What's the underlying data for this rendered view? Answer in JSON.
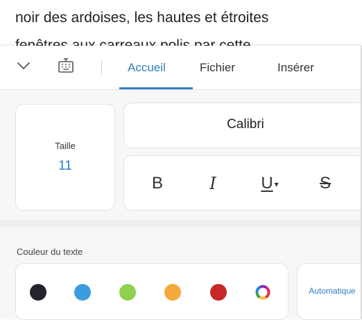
{
  "document": {
    "line1": "noir des ardoises, les hautes et étroites",
    "line2": "fenêtres aux carreaux polis par cette"
  },
  "toolbar": {
    "collapse_icon": "chevron-down-icon",
    "keyboard_icon": "keyboard-icon",
    "tabs": [
      {
        "label": "Accueil",
        "active": true
      },
      {
        "label": "Fichier",
        "active": false
      },
      {
        "label": "Insérer",
        "active": false
      }
    ]
  },
  "font": {
    "size_label": "Taille",
    "size_value": "11",
    "font_name": "Calibri",
    "format_buttons": {
      "bold": "B",
      "italic": "I",
      "underline": "U",
      "strikethrough": "S"
    }
  },
  "text_color": {
    "label": "Couleur du texte",
    "swatches": [
      {
        "name": "black",
        "color": "#23232b"
      },
      {
        "name": "blue",
        "color": "#3d9ce0"
      },
      {
        "name": "green",
        "color": "#8fd14f"
      },
      {
        "name": "orange",
        "color": "#f5a93a"
      },
      {
        "name": "red",
        "color": "#c62828"
      },
      {
        "name": "multicolor",
        "color": "conic"
      }
    ],
    "auto_label": "Automatique"
  },
  "colors": {
    "accent": "#2f7fc1"
  }
}
